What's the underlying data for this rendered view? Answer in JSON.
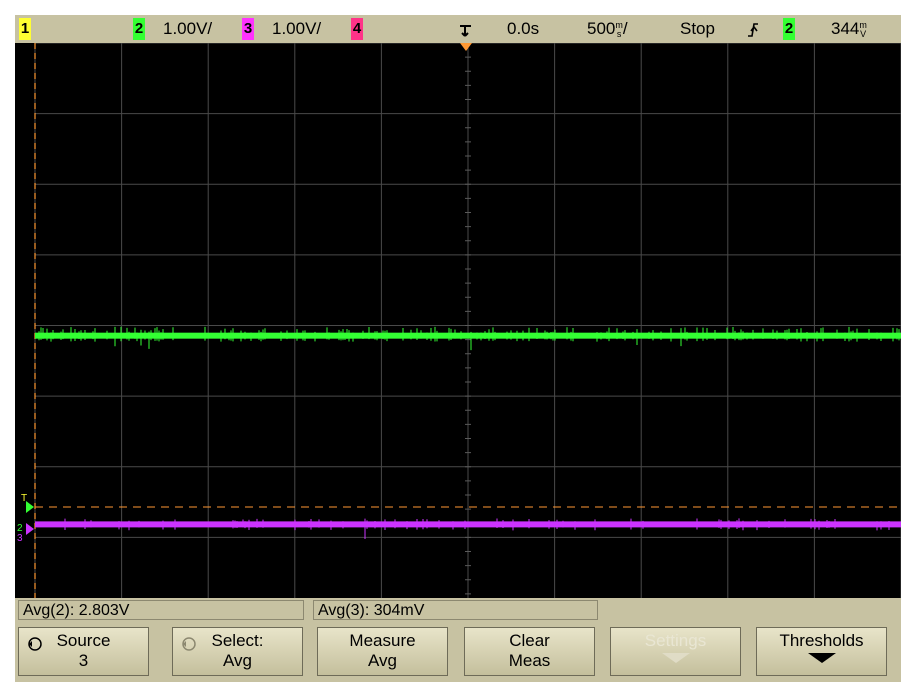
{
  "status_bar": {
    "ch1": {
      "number": "1",
      "color": "#ffff33"
    },
    "ch2": {
      "number": "2",
      "scale": "1.00V/",
      "color": "#33ff33"
    },
    "ch3": {
      "number": "3",
      "scale": "1.00V/",
      "color": "#ff33ff"
    },
    "ch4": {
      "number": "4",
      "color": "#ff3388"
    },
    "time_delay": "0.0s",
    "time_scale": "500",
    "time_scale_unit_top": "m",
    "time_scale_unit_bottom": "s",
    "time_scale_suffix": "/",
    "run_state": "Stop",
    "trigger_edge_icon": "rising-edge-icon",
    "trigger_source": "2",
    "trigger_level": "344",
    "trigger_level_unit_top": "m",
    "trigger_level_unit_bottom": "V"
  },
  "traces": {
    "ch2": {
      "color": "#33ff33",
      "level_fraction_from_top": 0.518
    },
    "ch3": {
      "color": "#cc33ff",
      "level_fraction_from_top": 0.852
    }
  },
  "markers": {
    "trigger_marker": "T",
    "ch2_marker": "2",
    "ch3_marker": "3"
  },
  "measurements": {
    "avg2": "Avg(2): 2.803V",
    "avg3": "Avg(3): 304mV"
  },
  "softkeys": [
    {
      "line1": "Source",
      "line2": "3",
      "enabled": true
    },
    {
      "line1": "Select:",
      "line2": "Avg",
      "enabled": true
    },
    {
      "line1": "Measure",
      "line2": "Avg",
      "enabled": true
    },
    {
      "line1": "Clear",
      "line2": "Meas",
      "enabled": true
    },
    {
      "line1": "Settings",
      "line2": "",
      "enabled": false
    },
    {
      "line1": "Thresholds",
      "line2": "",
      "enabled": true
    }
  ]
}
